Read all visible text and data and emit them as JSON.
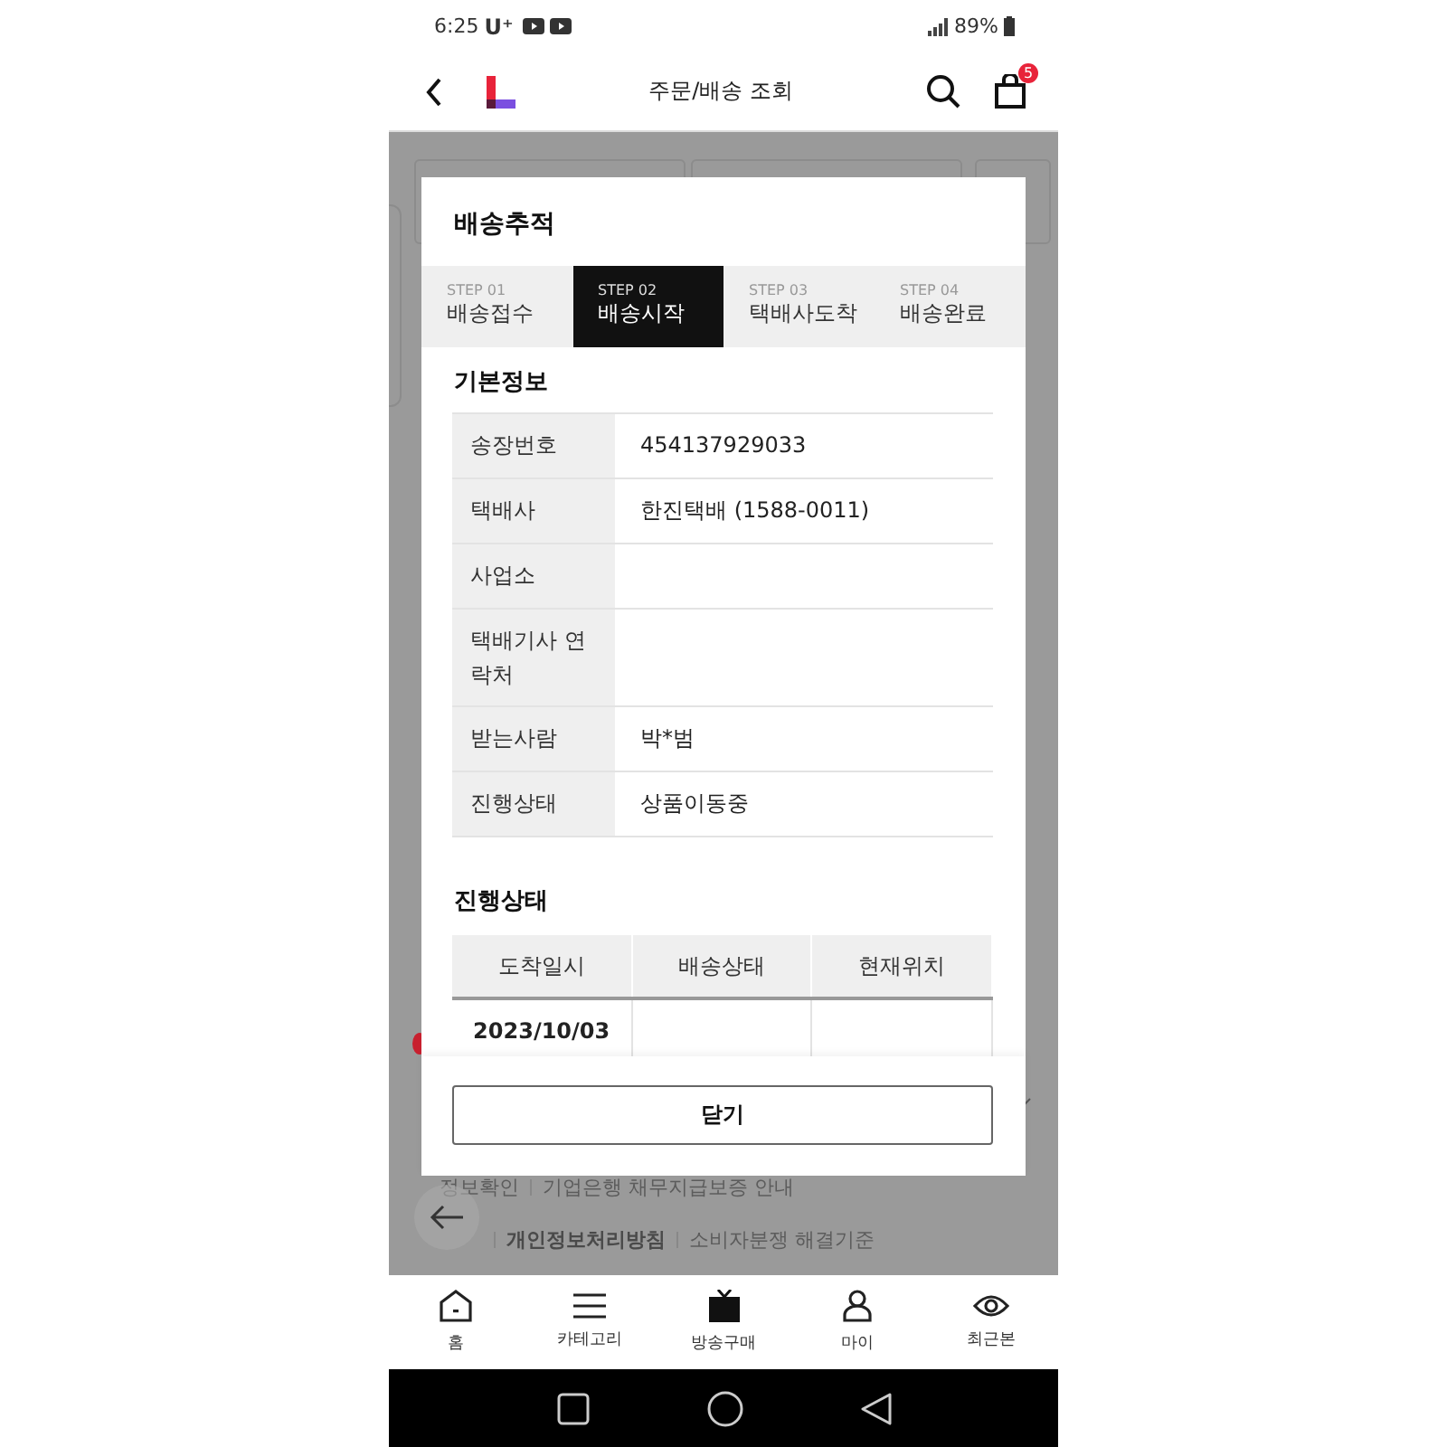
{
  "status_bar": {
    "time": "6:25",
    "carrier": "U⁺",
    "battery": "89%"
  },
  "header": {
    "title": "주문/배송 조회",
    "cart_count": "5"
  },
  "modal": {
    "title": "배송추적",
    "steps": [
      {
        "step": "STEP 01",
        "label": "배송접수",
        "selected": false
      },
      {
        "step": "STEP 02",
        "label": "배송시작",
        "selected": true
      },
      {
        "step": "STEP 03",
        "label": "택배사도착",
        "selected": false
      },
      {
        "step": "STEP 04",
        "label": "배송완료",
        "selected": false
      }
    ],
    "basic_info": {
      "heading": "기본정보",
      "rows": [
        {
          "label": "송장번호",
          "value": "454137929033"
        },
        {
          "label": "택배사",
          "value": "한진택배 (1588-0011)"
        },
        {
          "label": "사업소"
        },
        {
          "label": "택배기사 연락처"
        },
        {
          "label": "받는사람",
          "value": "박*범"
        },
        {
          "label": "진행상태",
          "value": "상품이동중"
        }
      ]
    },
    "progress": {
      "heading": "진행상태",
      "columns": [
        "도착일시",
        "배송상태",
        "현재위치"
      ],
      "rows": [
        [
          "2023/10/03"
        ]
      ]
    },
    "close_button": "닫기"
  },
  "background_links": [
    [
      {
        "text": "정보확인",
        "bold": false
      },
      {
        "text": "기업은행 채무지급보증 안내",
        "bold": false
      }
    ],
    [
      {
        "text": "개인정보처리방침",
        "bold": true
      },
      {
        "text": "소비자분쟁 해결기준",
        "bold": false
      }
    ]
  ],
  "bottom_nav": [
    {
      "label": "홈",
      "kind": "home"
    },
    {
      "label": "카테고리",
      "kind": "menu"
    },
    {
      "label": "방송구매",
      "kind": "tv"
    },
    {
      "label": "마이",
      "kind": "person"
    },
    {
      "label": "최근본",
      "kind": "eye"
    }
  ]
}
